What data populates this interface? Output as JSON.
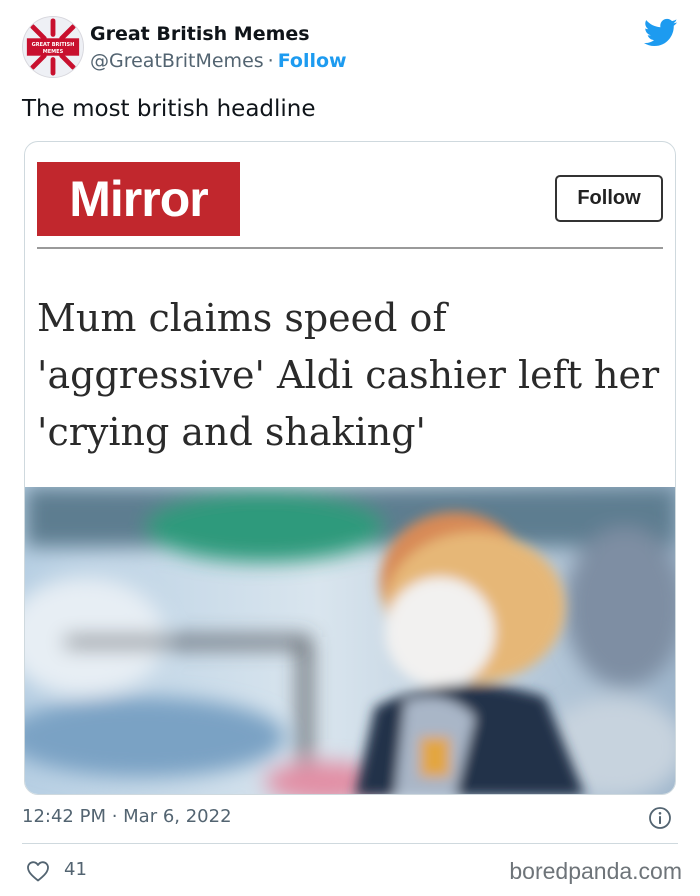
{
  "tweet": {
    "display_name": "Great British Memes",
    "handle": "@GreatBritMemes",
    "separator": "·",
    "follow_label": "Follow",
    "text": "The most british headline",
    "timestamp": "12:42 PM · Mar 6, 2022",
    "like_count": "41",
    "avatar_logo_text": "GREAT BRITISH MEMES"
  },
  "embedded_article": {
    "publisher_logo": "Mirror",
    "follow_label": "Follow",
    "headline_lines": [
      "Mum claims speed of",
      "'aggressive' Aldi cashier left her",
      "'crying and shaking'"
    ]
  },
  "watermark": "boredpanda.com",
  "colors": {
    "twitter_blue": "#1d9bf0",
    "mirror_red": "#c1272d",
    "secondary_text": "#536471"
  },
  "icons": {
    "brand": "twitter-bird-icon",
    "info": "info-icon",
    "like": "heart-icon"
  }
}
